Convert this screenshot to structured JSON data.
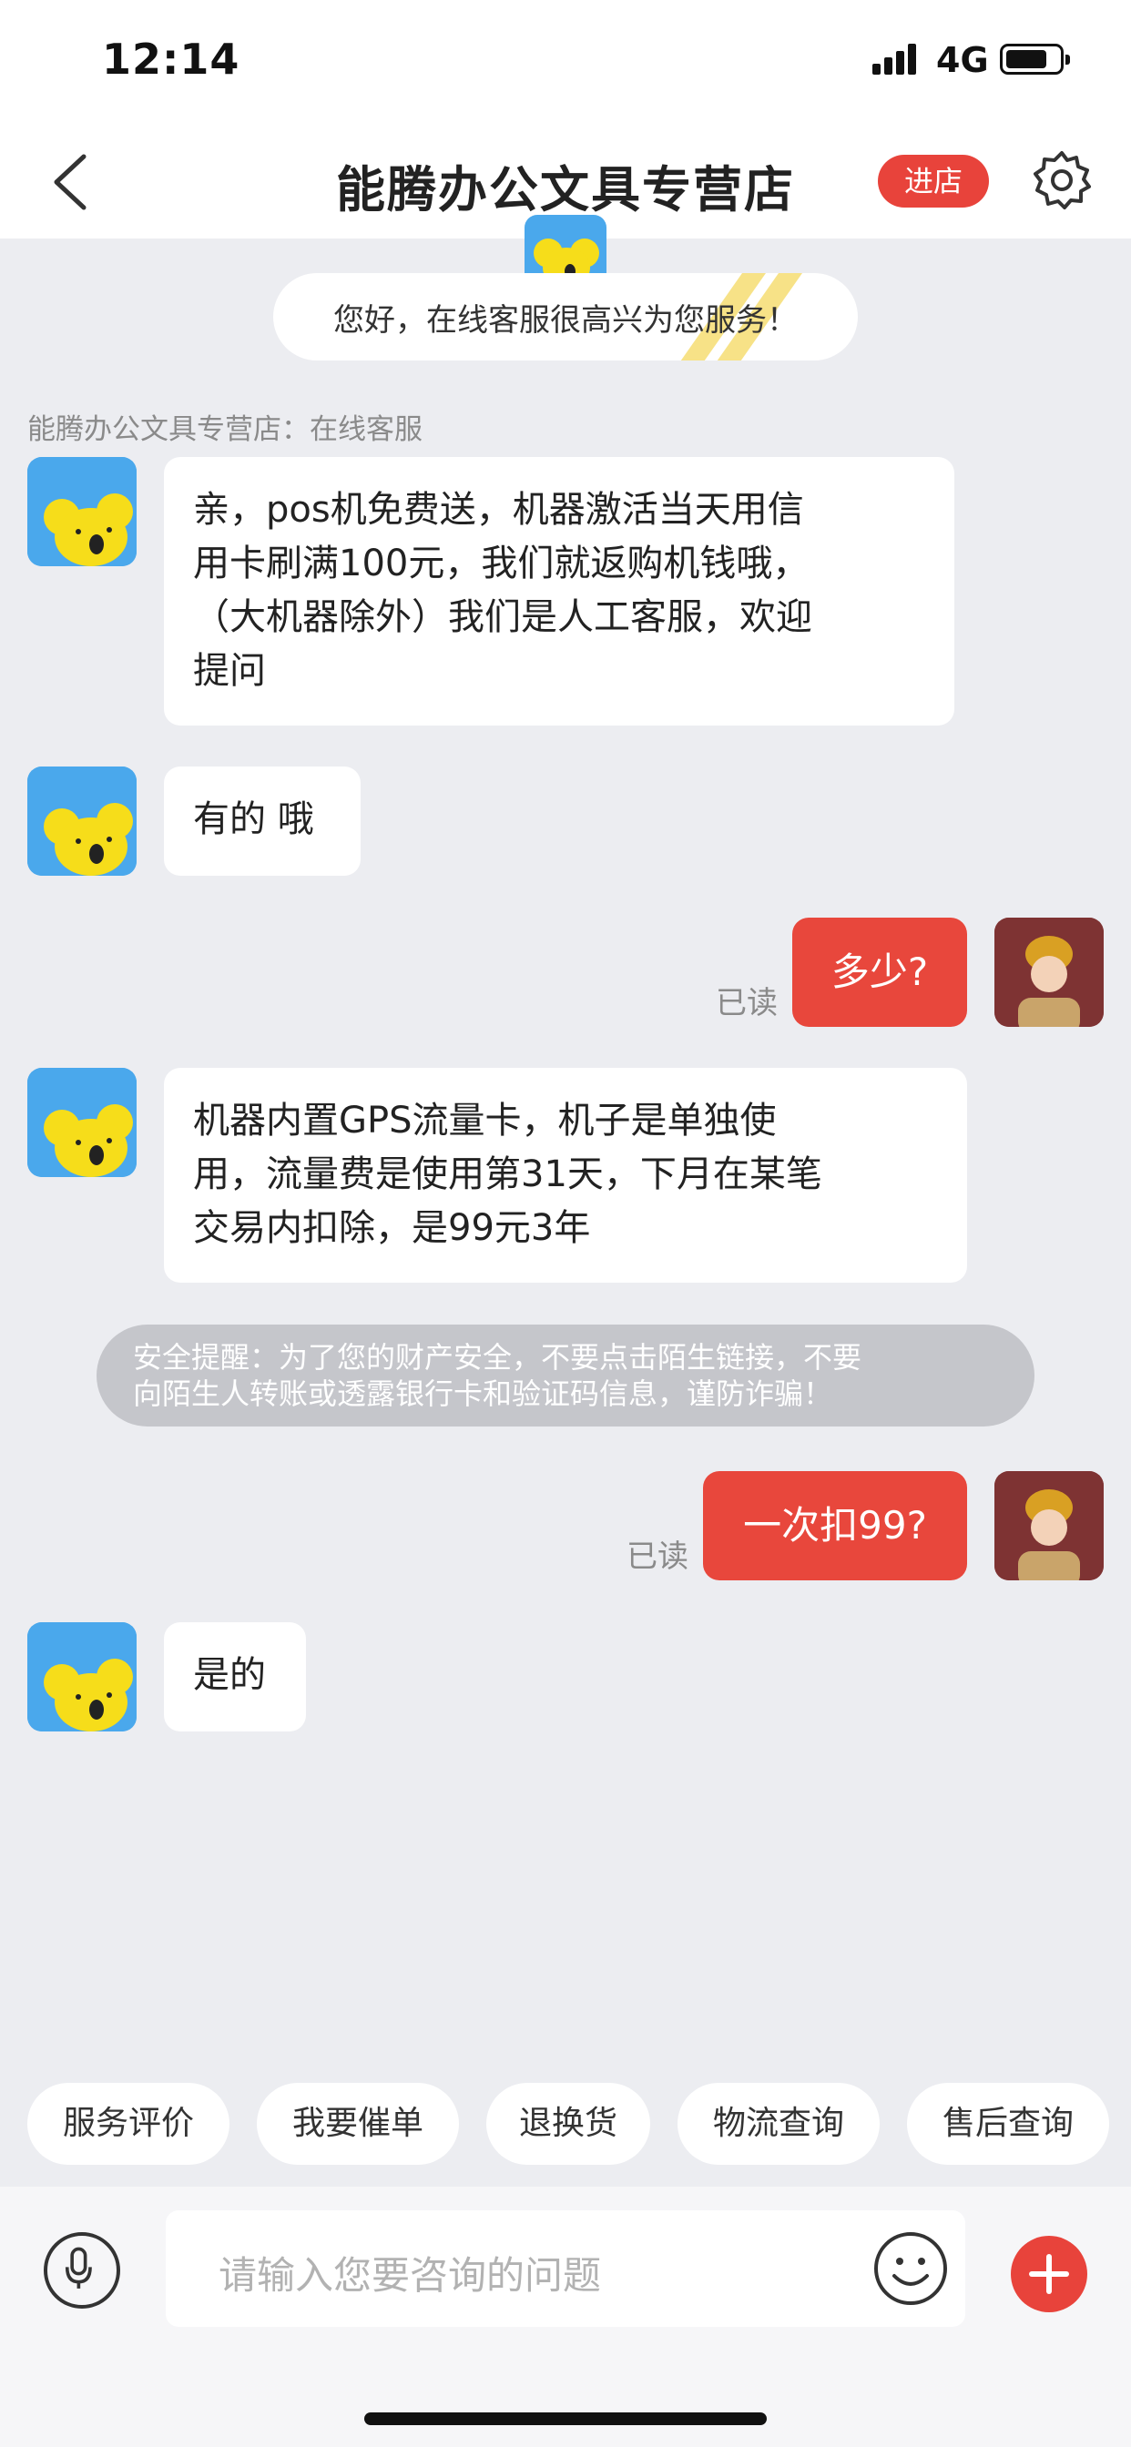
{
  "status_bar": {
    "time": "12:14",
    "network": "4G"
  },
  "header": {
    "title": "能腾办公文具专营店",
    "enter_label": "进店"
  },
  "welcome": {
    "text": "您好，在线客服很高兴为您服务！"
  },
  "shop_label": "能腾办公文具专营店：在线客服",
  "messages": [
    {
      "from": "shop",
      "lines": [
        "亲，pos机免费送，机器激活当天用信",
        "用卡刷满100元，我们就返购机钱哦，",
        "（大机器除外）我们是人工客服，欢迎",
        "提问"
      ]
    },
    {
      "from": "shop",
      "lines": [
        "有的 哦"
      ]
    },
    {
      "from": "user",
      "text": "多少?",
      "status": "已读"
    },
    {
      "from": "shop",
      "lines": [
        "机器内置GPS流量卡，机子是单独使",
        "用，流量费是使用第31天，下月在某笔",
        "交易内扣除，是99元3年"
      ]
    },
    {
      "from": "user",
      "text": "一次扣99?",
      "status": "已读"
    },
    {
      "from": "shop",
      "lines": [
        "是的"
      ]
    }
  ],
  "security_notice": {
    "line1": "安全提醒：为了您的财产安全，不要点击陌生链接，不要",
    "line2": "向陌生人转账或透露银行卡和验证码信息，谨防诈骗！"
  },
  "quick_actions": [
    "服务评价",
    "我要催单",
    "退换货",
    "物流查询",
    "售后查询"
  ],
  "input": {
    "placeholder": "请输入您要咨询的问题"
  },
  "icons": {
    "back": "chevron-left-icon",
    "settings": "gear-icon",
    "mic": "microphone-icon",
    "emoji": "smiley-icon",
    "plus": "plus-icon"
  },
  "colors": {
    "accent": "#e8433b",
    "background": "#ecedf1",
    "avatar_blue": "#4aa8ec",
    "koala_yellow": "#f6dd1a"
  }
}
